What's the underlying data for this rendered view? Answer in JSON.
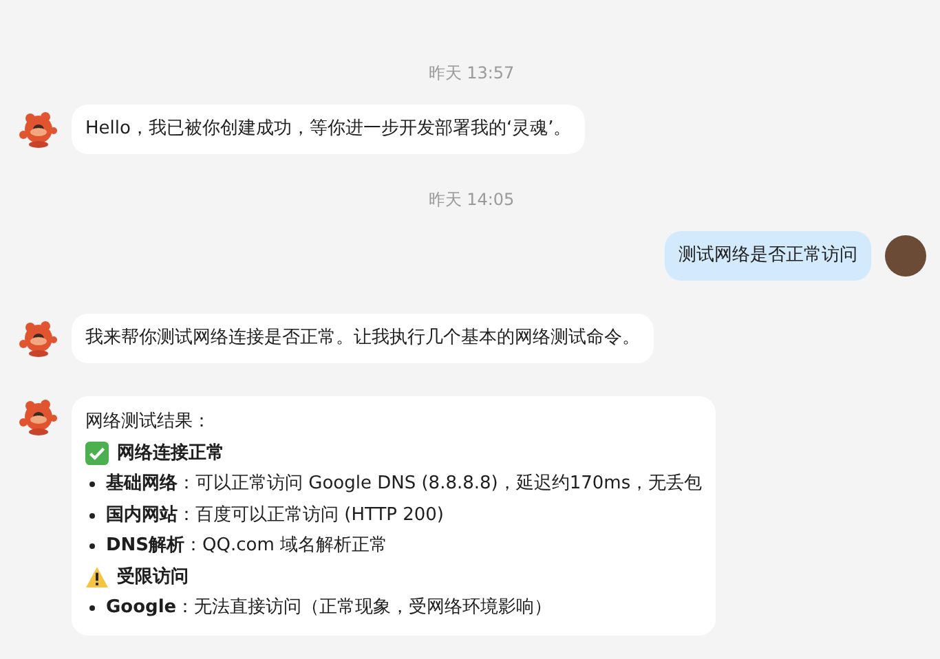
{
  "messages": [
    {
      "kind": "time",
      "text": "昨天 13:57"
    },
    {
      "kind": "bot",
      "text": "Hello，我已被你创建成功，等你进一步开发部署我的‘灵魂’。"
    },
    {
      "kind": "time",
      "text": "昨天 14:05"
    },
    {
      "kind": "user",
      "text": "测试网络是否正常访问"
    },
    {
      "kind": "bot",
      "text": "我来帮你测试网络连接是否正常。让我执行几个基本的网络测试命令。"
    },
    {
      "kind": "bot",
      "blocks": [
        {
          "kind": "para",
          "text": "网络测试结果："
        },
        {
          "kind": "ok_heading",
          "text": "网络连接正常"
        },
        {
          "kind": "bullet",
          "text": "**基础网络**：可以正常访问 Google DNS (8.8.8.8)，延迟约170ms，无丢包"
        },
        {
          "kind": "bullet",
          "text": "**国内网站**：百度可以正常访问 (HTTP 200)"
        },
        {
          "kind": "bullet",
          "text": "**DNS解析**：QQ.com 域名解析正常"
        },
        {
          "kind": "warn_heading",
          "text": "受限访问"
        },
        {
          "kind": "bullet",
          "text": "**Google**：无法直接访问（正常现象，受网络环境影响）"
        }
      ]
    }
  ]
}
